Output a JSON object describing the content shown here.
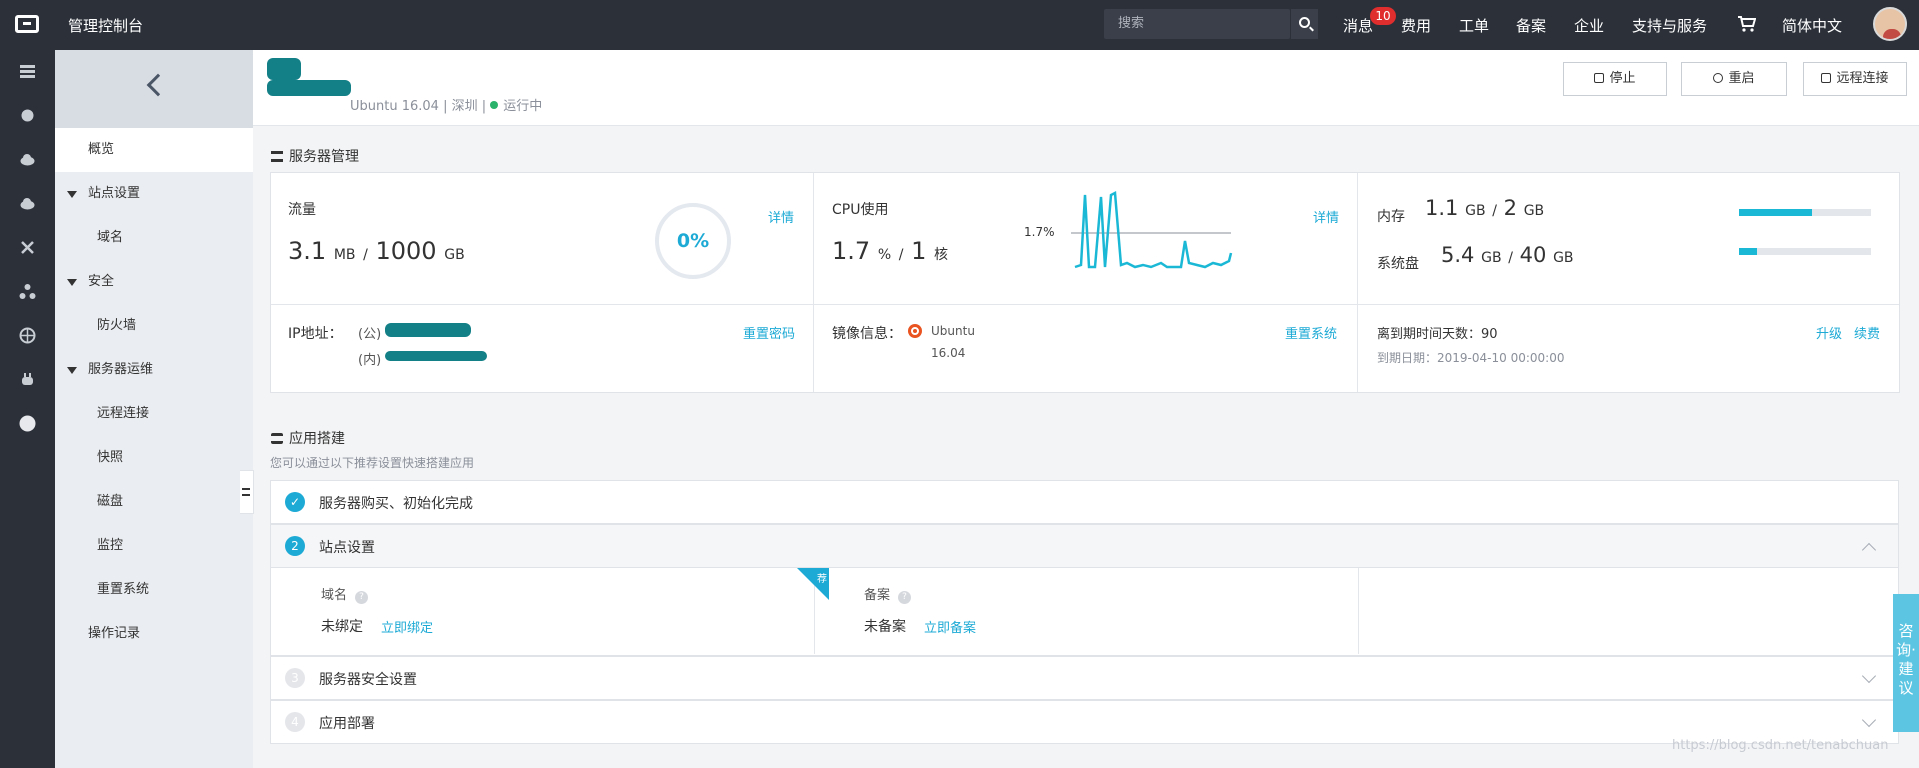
{
  "topbar": {
    "console_title": "管理控制台",
    "search_placeholder": "搜索",
    "nav": [
      "消息",
      "费用",
      "工单",
      "备案",
      "企业",
      "支持与服务",
      "简体中文"
    ],
    "message_badge": "10"
  },
  "rail_icons": [
    "server-icon",
    "box-icon",
    "cloud-icon",
    "cloud-upload-icon",
    "network-icon",
    "cluster-icon",
    "globe-icon",
    "plug-icon",
    "circle-icon"
  ],
  "subnav": {
    "items": [
      {
        "label": "概览",
        "type": "top",
        "active": true
      },
      {
        "label": "站点设置",
        "type": "group"
      },
      {
        "label": "域名",
        "type": "child"
      },
      {
        "label": "安全",
        "type": "group"
      },
      {
        "label": "防火墙",
        "type": "child"
      },
      {
        "label": "服务器运维",
        "type": "group"
      },
      {
        "label": "远程连接",
        "type": "child"
      },
      {
        "label": "快照",
        "type": "child"
      },
      {
        "label": "磁盘",
        "type": "child"
      },
      {
        "label": "监控",
        "type": "child"
      },
      {
        "label": "重置系统",
        "type": "child"
      },
      {
        "label": "操作记录",
        "type": "top"
      }
    ]
  },
  "server": {
    "os": "Ubuntu 16.04",
    "region": "深圳",
    "status": "运行中",
    "buttons": {
      "stop": "停止",
      "restart": "重启",
      "remote": "远程连接"
    }
  },
  "management": {
    "title": "服务器管理",
    "traffic": {
      "label": "流量",
      "used_value": "3.1",
      "used_unit": "MB",
      "sep": "/",
      "total_value": "1000",
      "total_unit": "GB",
      "percent": "0%",
      "details": "详情"
    },
    "cpu": {
      "label": "CPU使用",
      "value": "1.7",
      "unit": "%",
      "sep": "/",
      "cores": "1",
      "cores_unit": "核",
      "chart_label": "1.7%",
      "details": "详情"
    },
    "memory": {
      "label": "内存",
      "used": "1.1",
      "used_unit": "GB",
      "sep": "/",
      "total": "2",
      "total_unit": "GB",
      "fraction": 0.55
    },
    "disk": {
      "label": "系统盘",
      "used": "5.4",
      "used_unit": "GB",
      "sep": "/",
      "total": "40",
      "total_unit": "GB",
      "fraction": 0.135
    },
    "ip": {
      "label": "IP地址：",
      "public_prefix": "(公)",
      "private_prefix": "(内)",
      "reset_password": "重置密码"
    },
    "image": {
      "label": "镜像信息：",
      "name": "Ubuntu",
      "version": "16.04",
      "reset_system": "重置系统"
    },
    "expiry": {
      "label": "离到期时间天数：",
      "days": "90",
      "date_label": "到期日期：",
      "date": "2019-04-10 00:00:00",
      "upgrade": "升级",
      "renew": "续费"
    }
  },
  "app_setup": {
    "title": "应用搭建",
    "subtitle": "您可以通过以下推荐设置快速搭建应用",
    "steps": [
      {
        "num": "✓",
        "label": "服务器购买、初始化完成"
      },
      {
        "num": "2",
        "label": "站点设置"
      },
      {
        "num": "3",
        "label": "服务器安全设置"
      },
      {
        "num": "4",
        "label": "应用部署"
      }
    ],
    "domain": {
      "label": "域名",
      "status": "未绑定",
      "action": "立即绑定"
    },
    "beian": {
      "label": "备案",
      "status": "未备案",
      "action": "立即备案"
    },
    "recommend_tag": "荐"
  },
  "feedback": "咨询·建议",
  "watermark": "https://blog.csdn.net/tenabchuan"
}
